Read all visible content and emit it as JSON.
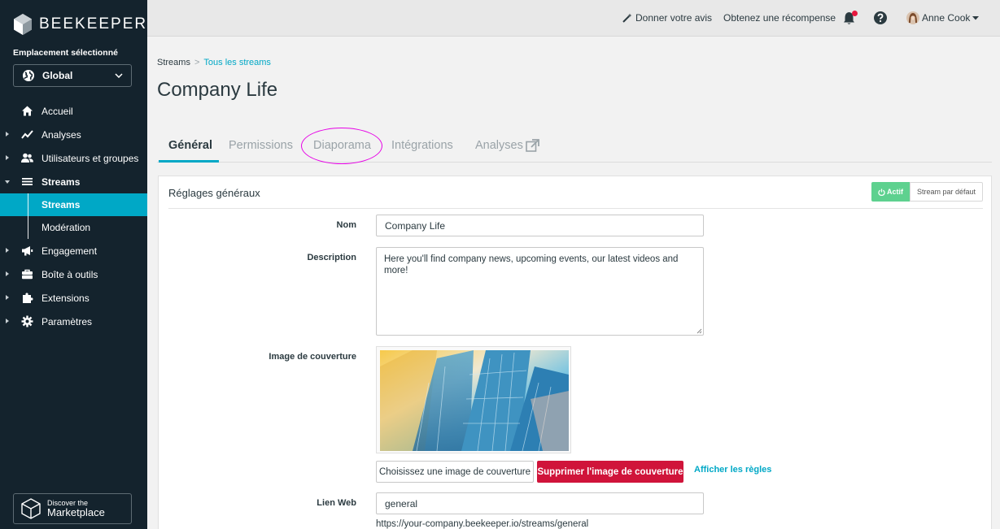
{
  "sidebar": {
    "logo_text": "BEEKEEPER",
    "location_label": "Emplacement sélectionné",
    "location_value": "Global",
    "items": [
      {
        "label": "Accueil",
        "icon": "home-icon"
      },
      {
        "label": "Analyses",
        "icon": "chart-line-icon"
      },
      {
        "label": "Utilisateurs et groupes",
        "icon": "users-icon"
      },
      {
        "label": "Streams",
        "icon": "list-icon"
      },
      {
        "label": "Streams"
      },
      {
        "label": "Modération"
      },
      {
        "label": "Engagement",
        "icon": "megaphone-icon"
      },
      {
        "label": "Boîte à outils",
        "icon": "toolbox-icon"
      },
      {
        "label": "Extensions",
        "icon": "puzzle-icon"
      },
      {
        "label": "Paramètres",
        "icon": "gear-icon"
      }
    ],
    "marketplace_line1": "Discover the",
    "marketplace_line2": "Marketplace"
  },
  "topbar": {
    "feedback": "Donner votre avis",
    "reward": "Obtenez une récompense",
    "user_name": "Anne Cook"
  },
  "breadcrumb": {
    "root": "Streams",
    "separator": ">",
    "link": "Tous les streams"
  },
  "page_title": "Company Life",
  "tabs": [
    "Général",
    "Permissions",
    "Diaporama",
    "Intégrations",
    "Analyses"
  ],
  "panel": {
    "title": "Réglages généraux",
    "active_label": "Actif",
    "default_stream_label": "Stream par défaut",
    "fields": {
      "name_label": "Nom",
      "name_value": "Company Life",
      "description_label": "Description",
      "description_value": "Here you'll find company news, upcoming events, our latest videos and more!",
      "cover_label": "Image de couverture",
      "choose_cover": "Choisissez une image de couverture",
      "delete_cover": "Supprimer l'image de couverture",
      "show_rules": "Afficher les règles",
      "web_link_label": "Lien Web",
      "web_link_value": "general",
      "web_link_url": "https://your-company.beekeeper.io/streams/general"
    }
  },
  "colors": {
    "sidebar_bg": "#14232d",
    "accent": "#00a8c6",
    "active_green": "#5ed18f",
    "danger": "#d0143a",
    "highlight_circle": "#e600e6"
  }
}
